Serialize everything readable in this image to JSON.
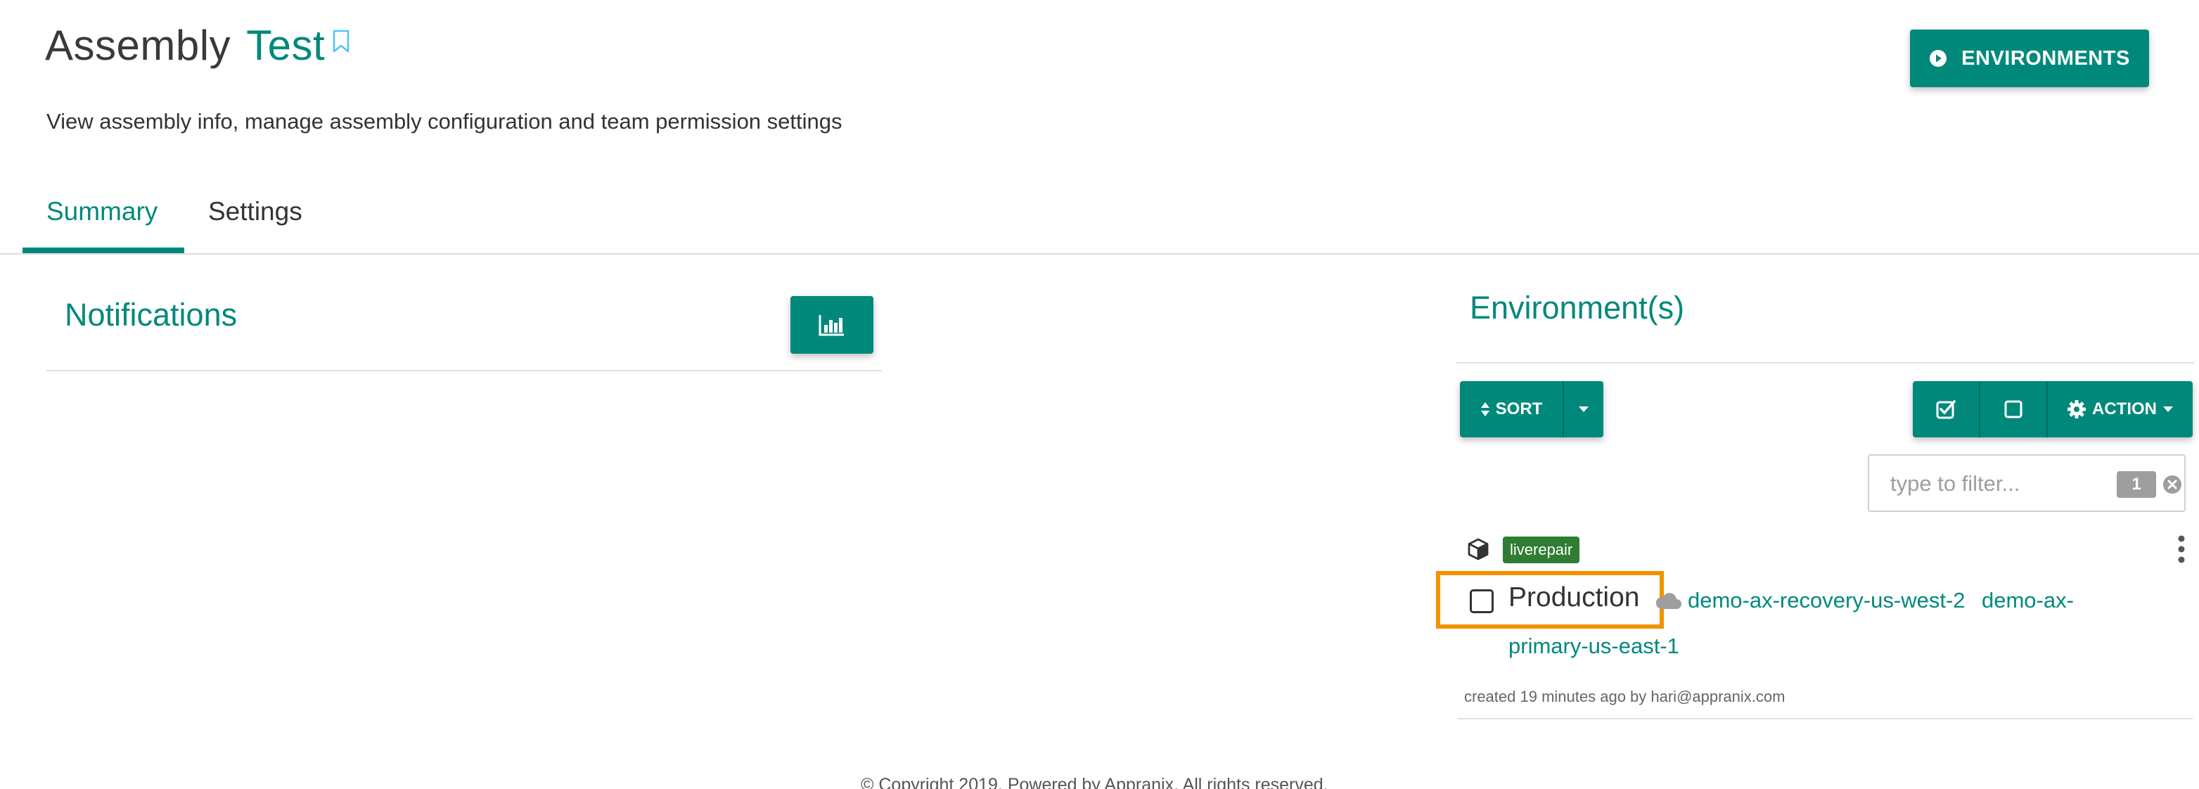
{
  "header": {
    "title_main": "Assembly",
    "title_accent": "Test",
    "subtitle": "View assembly info, manage assembly configuration and team permission settings",
    "environments_button": "ENVIRONMENTS"
  },
  "tabs": [
    {
      "label": "Summary",
      "active": true
    },
    {
      "label": "Settings",
      "active": false
    }
  ],
  "notifications": {
    "title": "Notifications"
  },
  "environments": {
    "title": "Environment(s)",
    "sort_label": "SORT",
    "action_label": "ACTION",
    "filter": {
      "placeholder": "type to filter...",
      "count": "1"
    },
    "items": [
      {
        "badge": "liverepair",
        "name": "Production",
        "cloud_1": "demo-ax-recovery-us-west-2",
        "cloud_2_part1": "demo-ax-",
        "cloud_2_part2": "primary-us-east-1",
        "created": "created 19 minutes ago by hari@appranix.com"
      }
    ]
  },
  "footer": {
    "copyright": "© Copyright 2019. Powered by Appranix. All rights reserved."
  },
  "colors": {
    "accent": "#00897b",
    "badge": "#2e7d32",
    "highlight": "#f39200"
  }
}
